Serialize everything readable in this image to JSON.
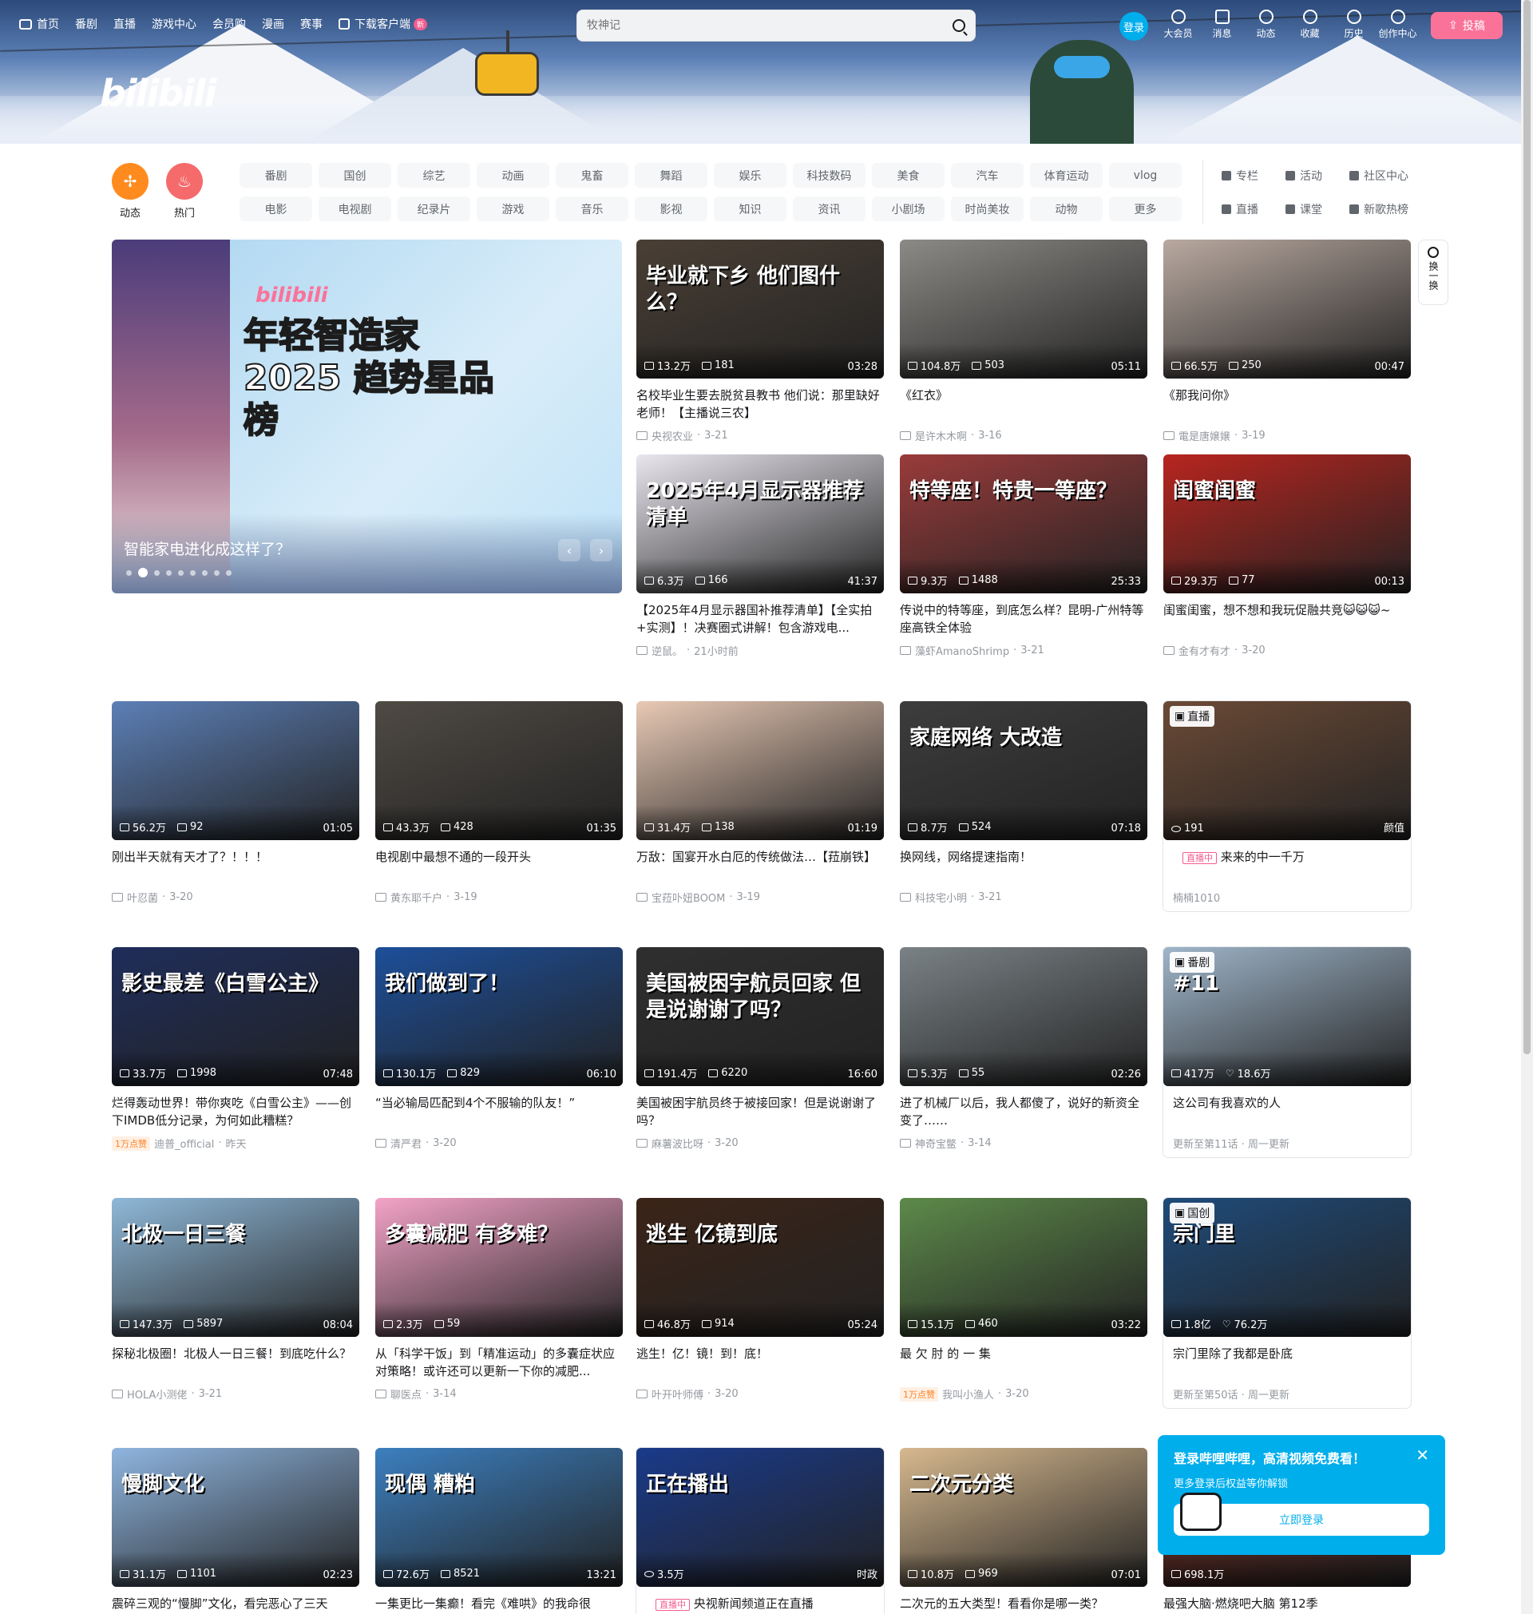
{
  "topnav": {
    "items": [
      "首页",
      "番剧",
      "直播",
      "游戏中心",
      "会员购",
      "漫画",
      "赛事"
    ],
    "download": "下载客户端",
    "new_badge": "新"
  },
  "search": {
    "placeholder": "牧神记"
  },
  "user": {
    "login": "登录"
  },
  "right_icons": [
    "大会员",
    "消息",
    "动态",
    "收藏",
    "历史",
    "创作中心"
  ],
  "upload_label": "投稿",
  "logo": "bilibili",
  "channel_left": [
    {
      "label": "动态",
      "color": "#ff8b1f"
    },
    {
      "label": "热门",
      "color": "#f56b6b"
    }
  ],
  "channels": [
    "番剧",
    "国创",
    "综艺",
    "动画",
    "鬼畜",
    "舞蹈",
    "娱乐",
    "科技数码",
    "美食",
    "汽车",
    "体育运动",
    "vlog",
    "电影",
    "电视剧",
    "纪录片",
    "游戏",
    "音乐",
    "影视",
    "知识",
    "资讯",
    "小剧场",
    "时尚美妆",
    "动物",
    "更多"
  ],
  "channel_right": [
    "专栏",
    "活动",
    "社区中心",
    "直播",
    "课堂",
    "新歌热榜"
  ],
  "refresh_label": "换一换",
  "carousel": {
    "title": "智能家电进化成这样了？",
    "poster_brand": "bilibili",
    "poster_text": "年轻智造家 2025 趋势星品榜",
    "dot_count": 9,
    "active_dot": 1
  },
  "cards": [
    {
      "title": "名校毕业生要去脱贫县教书 他们说：那里缺好老师！【主播说三农】",
      "views": "13.2万",
      "danmaku": "181",
      "duration": "03:28",
      "author": "央视农业",
      "date": "3-21",
      "thumb_text": "毕业就下乡 他们图什么？",
      "bg": "#4a3f35"
    },
    {
      "title": "《红衣》",
      "views": "104.8万",
      "danmaku": "503",
      "duration": "05:11",
      "author": "是许木木啊",
      "date": "3-16",
      "thumb_text": "",
      "bg": "#8c8a86"
    },
    {
      "title": "《那我问你》",
      "views": "66.5万",
      "danmaku": "250",
      "duration": "00:47",
      "author": "電是唐嬢嬢",
      "date": "3-19",
      "thumb_text": "",
      "bg": "#b9a9a0"
    },
    {
      "title": "【2025年4月显示器国补推荐清单】【全实拍+实测】！决赛圈式讲解！包含游戏电...",
      "views": "6.3万",
      "danmaku": "166",
      "duration": "41:37",
      "author": "逆鼠。",
      "date": "21小时前",
      "thumb_text": "2025年4月显示器推荐清单",
      "bg": "#e9e6ee"
    },
    {
      "title": "传说中的特等座，到底怎么样？昆明-广州特等座高铁全体验",
      "views": "9.3万",
      "danmaku": "1488",
      "duration": "25:33",
      "author": "藻虾AmanoShrimp",
      "date": "3-21",
      "thumb_text": "特等座！特贵一等座？",
      "bg": "#9a3b3b"
    },
    {
      "title": "闺蜜闺蜜，想不想和我玩促融共竞😺😺😺~",
      "views": "29.3万",
      "danmaku": "77",
      "duration": "00:13",
      "author": "金有才有才",
      "date": "3-20",
      "thumb_text": "闺蜜闺蜜",
      "bg": "#b8251f"
    },
    {
      "title": "刚出半天就有天才了？！！！",
      "views": "56.2万",
      "danmaku": "92",
      "duration": "01:05",
      "author": "叶忍菌",
      "date": "3-20",
      "thumb_text": "",
      "bg": "#5c7fb6"
    },
    {
      "title": "电视剧中最想不通的一段开头",
      "views": "43.3万",
      "danmaku": "428",
      "duration": "01:35",
      "author": "黄东耶千户",
      "date": "3-19",
      "thumb_text": "",
      "bg": "#4f4a44"
    },
    {
      "title": "万敌：国宴开水白厄的传统做法…【菈崩铁】",
      "views": "31.4万",
      "danmaku": "138",
      "duration": "01:19",
      "author": "宝菈卟妞BOOM",
      "date": "3-19",
      "thumb_text": "",
      "bg": "#e8c9b5"
    },
    {
      "title": "换网线，网络提速指南！",
      "views": "8.7万",
      "danmaku": "524",
      "duration": "07:18",
      "author": "科技宅小明",
      "date": "3-21",
      "thumb_text": "家庭网络 大改造",
      "bg": "#3d3d3d"
    },
    {
      "title": "来来的中一千万",
      "views": "191",
      "danmaku": "",
      "duration": "颜值",
      "author": "楠楠1010",
      "date": "",
      "thumb_text": "",
      "bg": "#6b4a36",
      "tag": "直播",
      "live": "直播中",
      "eye": true
    },
    {
      "title": "烂得轰动世界！带你爽吃《白雪公主》——创下IMDB低分记录，为何如此糟糕？",
      "views": "33.7万",
      "danmaku": "1998",
      "duration": "07:48",
      "author": "迪普_official",
      "date": "昨天",
      "thumb_text": "影史最差《白雪公主》",
      "bg": "#1f2d5a",
      "likes": "1万点赞"
    },
    {
      "title": "“当必输局匹配到4个不服输的队友！”",
      "views": "130.1万",
      "danmaku": "829",
      "duration": "06:10",
      "author": "清严君",
      "date": "3-20",
      "thumb_text": "我们做到了！",
      "bg": "#1d4f9a"
    },
    {
      "title": "美国被困宇航员终于被接回家！但是说谢谢了吗？",
      "views": "191.4万",
      "danmaku": "6220",
      "duration": "16:60",
      "author": "麻薯波比呀",
      "date": "3-20",
      "thumb_text": "美国被困宇航员回家 但是说谢谢了吗？",
      "bg": "#2f2f2f"
    },
    {
      "title": "进了机械厂以后，我人都傻了，说好的新资全变了……",
      "views": "5.3万",
      "danmaku": "55",
      "duration": "02:26",
      "author": "神奇宝鳖",
      "date": "3-14",
      "thumb_text": "",
      "bg": "#7a8286"
    },
    {
      "title": "这公司有我喜欢的人",
      "views": "417万",
      "danmaku": "18.6万",
      "duration": "",
      "author": "更新至第11话 · 周一更新",
      "date": "",
      "thumb_text": "#11",
      "bg": "#9fb5c9",
      "tag": "番剧",
      "heart": true
    },
    {
      "title": "探秘北极圈！北极人一日三餐！到底吃什么？",
      "views": "147.3万",
      "danmaku": "5897",
      "duration": "08:04",
      "author": "HOLA小测佬",
      "date": "3-21",
      "thumb_text": "北极一日三餐",
      "bg": "#8fb8d8"
    },
    {
      "title": "从「科学干饭」到「精准运动」的多囊症状应对策略！或许还可以更新一下你的减肥...",
      "views": "2.3万",
      "danmaku": "59",
      "duration": "",
      "author": "聊医点",
      "date": "3-14",
      "thumb_text": "多囊减肥 有多难？",
      "bg": "#f3a3c7"
    },
    {
      "title": "逃生！亿！镜！到！底！",
      "views": "46.8万",
      "danmaku": "914",
      "duration": "05:24",
      "author": "叶开叶师傅",
      "date": "3-20",
      "thumb_text": "逃生 亿镜到底",
      "bg": "#3b2418"
    },
    {
      "title": "最 欠 肘 的 一 集",
      "views": "15.1万",
      "danmaku": "460",
      "duration": "03:22",
      "author": "我叫小渔人",
      "date": "3-20",
      "thumb_text": "",
      "bg": "#5d8a4a",
      "likes": "1万点赞"
    },
    {
      "title": "宗门里除了我都是卧底",
      "views": "1.8亿",
      "danmaku": "76.2万",
      "duration": "",
      "author": "更新至第50话 · 周一更新",
      "date": "",
      "thumb_text": "宗门里",
      "bg": "#1f4b7a",
      "tag": "国创",
      "heart": true
    },
    {
      "title": "震碎三观的“慢脚”文化，看完恶心了三天",
      "views": "31.1万",
      "danmaku": "1101",
      "duration": "02:23",
      "author": "",
      "date": "",
      "thumb_text": "慢脚文化",
      "bg": "#8fb5df"
    },
    {
      "title": "一集更比一集癫！看完《难哄》的我命很",
      "views": "72.6万",
      "danmaku": "8521",
      "duration": "13:21",
      "author": "",
      "date": "",
      "thumb_text": "现偶 糟粕",
      "bg": "#3c7fbf"
    },
    {
      "title": "央视新闻频道正在直播",
      "views": "3.5万",
      "danmaku": "",
      "duration": "时政",
      "author": "",
      "date": "",
      "thumb_text": "正在播出",
      "bg": "#1a3a8a",
      "live": "直播中",
      "eye": true
    },
    {
      "title": "二次元的五大类型！看看你是哪一类？",
      "views": "10.8万",
      "danmaku": "969",
      "duration": "07:01",
      "author": "",
      "date": "",
      "thumb_text": "二次元分类",
      "bg": "#d7b98f"
    },
    {
      "title": "最强大脑·燃烧吧大脑 第12季",
      "views": "698.1万",
      "danmaku": "",
      "duration": "",
      "author": "",
      "date": "",
      "thumb_text": "",
      "bg": "#7a2c20"
    }
  ],
  "popup": {
    "title": "登录哔哩哔哩，高清视频免费看！",
    "subtitle": "更多登录后权益等你解锁",
    "button": "立即登录",
    "close": "✕"
  }
}
